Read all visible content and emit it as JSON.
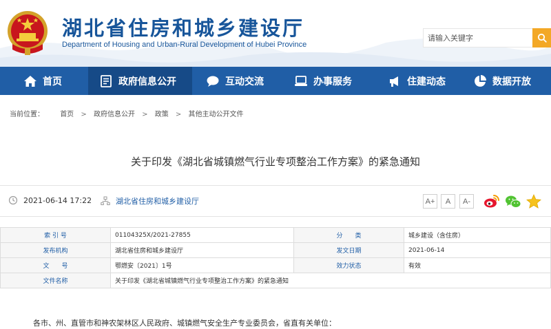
{
  "header": {
    "title": "湖北省住房和城乡建设厅",
    "subtitle": "Department of Housing and Urban-Rural Development of Hubei Province",
    "search_placeholder": "请输入关键字"
  },
  "nav": {
    "items": [
      {
        "label": "首页",
        "icon": "home-icon"
      },
      {
        "label": "政府信息公开",
        "icon": "document-icon"
      },
      {
        "label": "互动交流",
        "icon": "chat-bubble-icon"
      },
      {
        "label": "办事服务",
        "icon": "laptop-icon"
      },
      {
        "label": "住建动态",
        "icon": "megaphone-icon"
      },
      {
        "label": "数据开放",
        "icon": "pie-chart-icon"
      }
    ],
    "active_index": 1
  },
  "breadcrumb": {
    "prefix": "当前位置：",
    "items": [
      "首页",
      "政府信息公开",
      "政策",
      "其他主动公开文件"
    ]
  },
  "article": {
    "title": "关于印发《湖北省城镇燃气行业专项整治工作方案》的紧急通知",
    "date": "2021-06-14 17:22",
    "source": "湖北省住房和城乡建设厅",
    "font_sizes": [
      "A+",
      "A",
      "A-"
    ],
    "share": [
      "weibo-icon",
      "wechat-icon",
      "favorite-star-icon"
    ]
  },
  "info": {
    "index_label": "索 引 号",
    "index_value": "01104325X/2021-27855",
    "category_label": "分　　类",
    "category_value": "城乡建设（含住房）",
    "issuer_label": "发布机构",
    "issuer_value": "湖北省住房和城乡建设厅",
    "date_label": "发文日期",
    "date_value": "2021-06-14",
    "docno_label": "文　　号",
    "docno_value": "鄂燃安〔2021〕1号",
    "status_label": "效力状态",
    "status_value": "有效",
    "filename_label": "文件名称",
    "filename_value": "关于印发《湖北省城镇燃气行业专项整治工作方案》的紧急通知"
  },
  "body": {
    "first_line": "各市、州、直管市和神农架林区人民政府、城镇燃气安全生产专业委员会，省直有关单位："
  },
  "colors": {
    "brand_blue": "#205ea6",
    "nav_active": "#164a87",
    "search_button": "#f3a826",
    "title_blue": "#17559a"
  }
}
